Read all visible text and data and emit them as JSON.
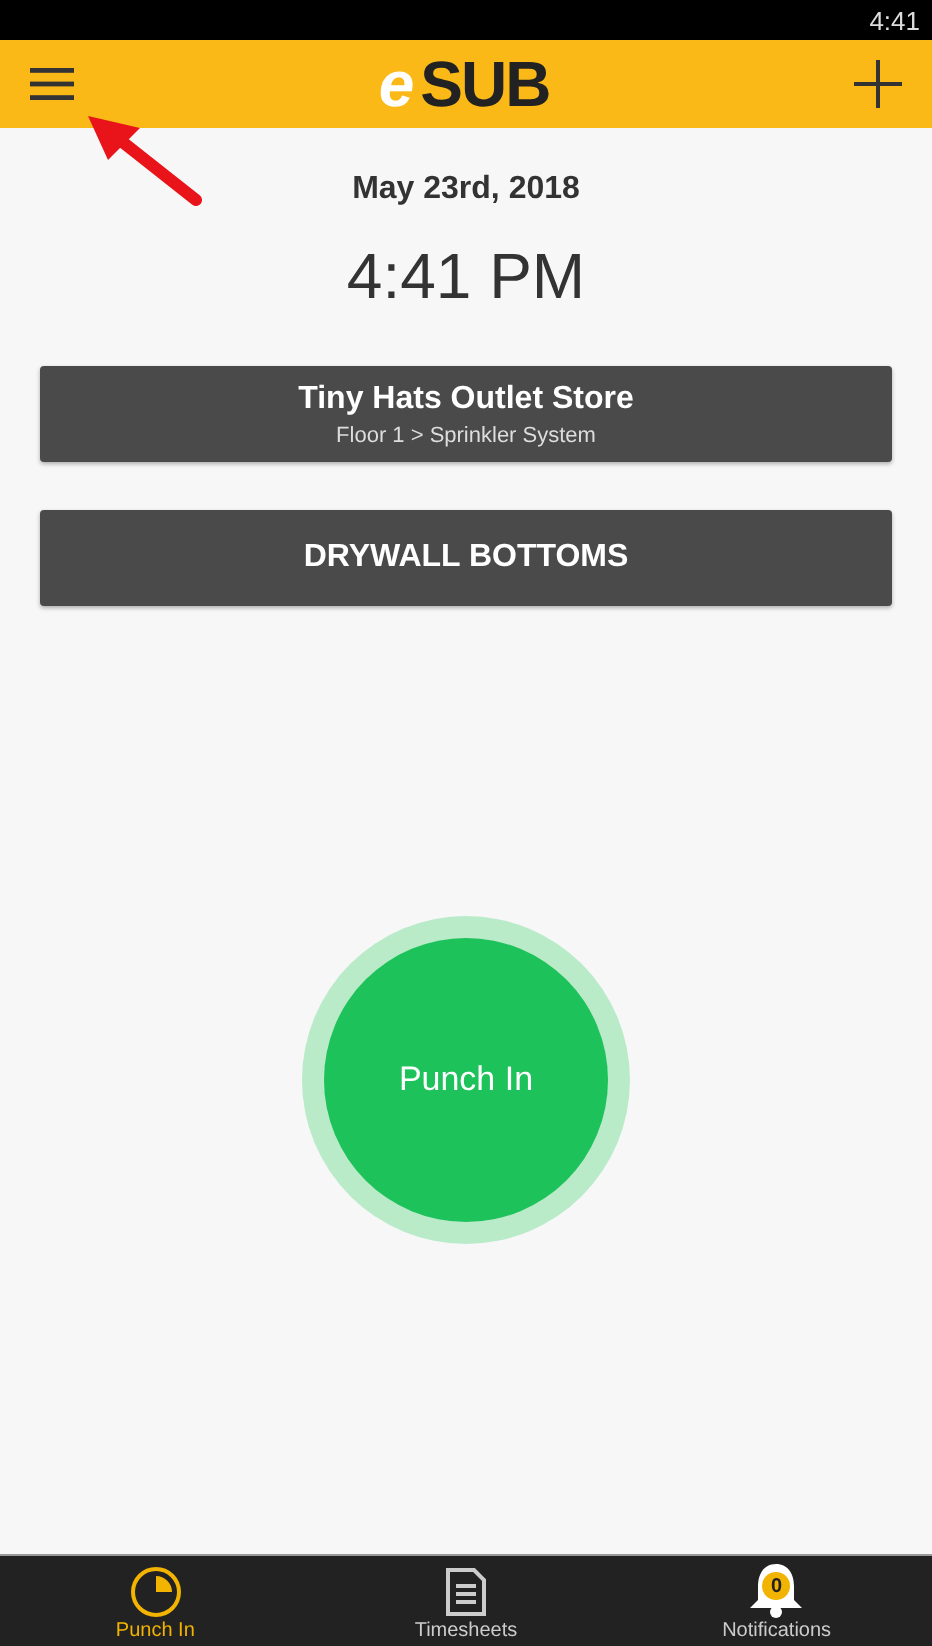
{
  "status_bar": {
    "time": "4:41"
  },
  "header": {
    "logo_prefix": "e",
    "logo_name": "SUB"
  },
  "date": "May 23rd, 2018",
  "time": "4:41 PM",
  "job": {
    "title": "Tiny Hats Outlet Store",
    "path": "Floor 1 > Sprinkler System"
  },
  "cost_code": "DRYWALL BOTTOMS",
  "punch_button": "Punch In",
  "tabs": [
    {
      "label": "Punch In",
      "kind": "clock",
      "selected": true
    },
    {
      "label": "Timesheets",
      "kind": "sheet",
      "selected": false
    },
    {
      "label": "Notifications",
      "kind": "bell",
      "selected": false,
      "badge": "0"
    }
  ]
}
